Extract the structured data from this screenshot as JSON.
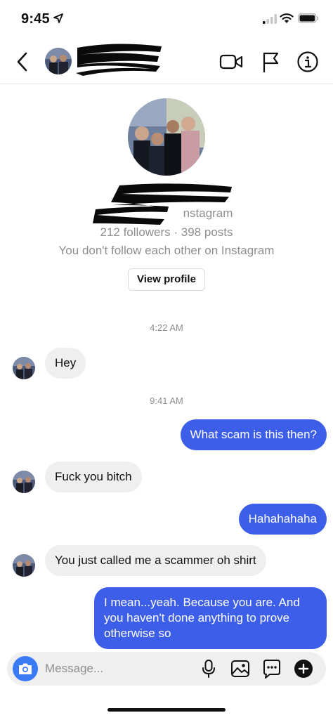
{
  "status_bar": {
    "time": "9:45",
    "icons": [
      "location-arrow-icon",
      "signal-icon",
      "wifi-icon",
      "battery-icon"
    ]
  },
  "header": {
    "icons": [
      "back-chevron-icon",
      "video-camera-icon",
      "flag-icon",
      "info-icon"
    ]
  },
  "profile": {
    "source": "nstagram",
    "stats": "212 followers · 398 posts",
    "follow_status": "You don't follow each other on Instagram",
    "view_profile_label": "View profile"
  },
  "conversation": {
    "timestamps": [
      "4:22 AM",
      "9:41 AM"
    ],
    "messages": [
      {
        "direction": "in",
        "text": "Hey"
      },
      {
        "direction": "out",
        "text": "What scam is this then?"
      },
      {
        "direction": "in",
        "text": "Fuck you bitch"
      },
      {
        "direction": "out",
        "text": "Hahahahaha"
      },
      {
        "direction": "in",
        "text": "You just called me a scammer oh shirt"
      },
      {
        "direction": "out",
        "text": "I mean...yeah. Because you are. And you haven't done anything to prove otherwise so"
      }
    ]
  },
  "composer": {
    "placeholder": "Message...",
    "icons": [
      "camera-icon",
      "microphone-icon",
      "gallery-icon",
      "sticker-icon",
      "plus-icon"
    ]
  },
  "colors": {
    "outgoing_bubble": "#3c5ee8",
    "incoming_bubble": "#efefef",
    "camera_button": "#3a7bf5",
    "muted_text": "#8e8e8e"
  }
}
